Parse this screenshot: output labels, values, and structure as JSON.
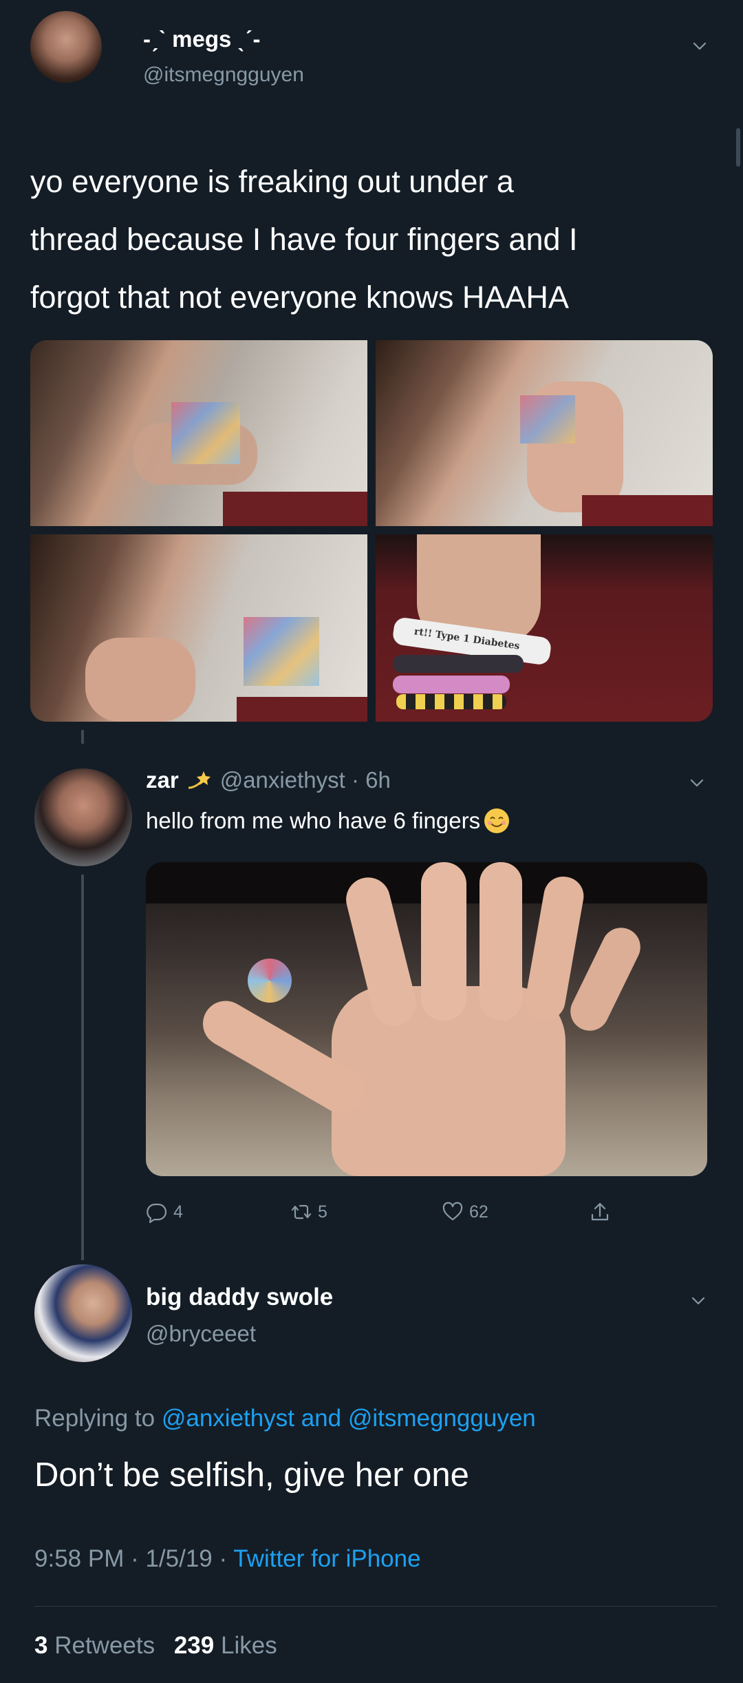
{
  "tweet1": {
    "display_name": "-ˏˋ megs ˎˊ-",
    "handle": "@itsmegngguyen",
    "text_line1": "yo everyone is freaking out under a",
    "text_line2": "thread because I have four fingers and I",
    "text_line3": "forgot that not everyone knows HAAHA",
    "photos": [
      "photo-1",
      "photo-2",
      "photo-3",
      "photo-4"
    ],
    "wristband_text": "rt!! Type 1 Diabetes"
  },
  "reply": {
    "display_name": "zar",
    "handle_time": "@anxiethyst · 6h",
    "text": "hello from me who have 6 fingers",
    "emoji": "☺",
    "replies": "4",
    "retweets": "5",
    "likes": "62"
  },
  "tweet2": {
    "display_name": "big daddy swole",
    "handle": "@bryceeet",
    "replying_prefix": "Replying to",
    "replying_user1": "@anxiethyst",
    "replying_and": "and",
    "replying_user2": "@itsmegngguyen",
    "text": "Don’t be selfish, give her one",
    "time_date": "9:58 PM · 1/5/19 ·",
    "source": "Twitter for iPhone",
    "retweets_count": "3",
    "retweets_label": "Retweets",
    "likes_count": "239",
    "likes_label": "Likes"
  },
  "colors": {
    "background": "#141d26",
    "muted": "#8899a6",
    "link": "#1da1f2"
  }
}
